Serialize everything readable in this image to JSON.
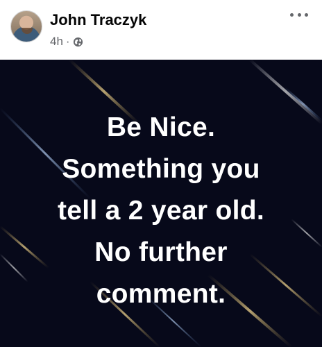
{
  "post": {
    "author": "John Traczyk",
    "time": "4h",
    "separator": "·",
    "privacy_icon": "globe-icon",
    "menu_icon": "more-options-icon",
    "lines": [
      "Be Nice.",
      "Something you",
      "tell a 2 year old.",
      "No further",
      "comment."
    ],
    "background_color": "#07091a",
    "text_color": "#ffffff"
  }
}
